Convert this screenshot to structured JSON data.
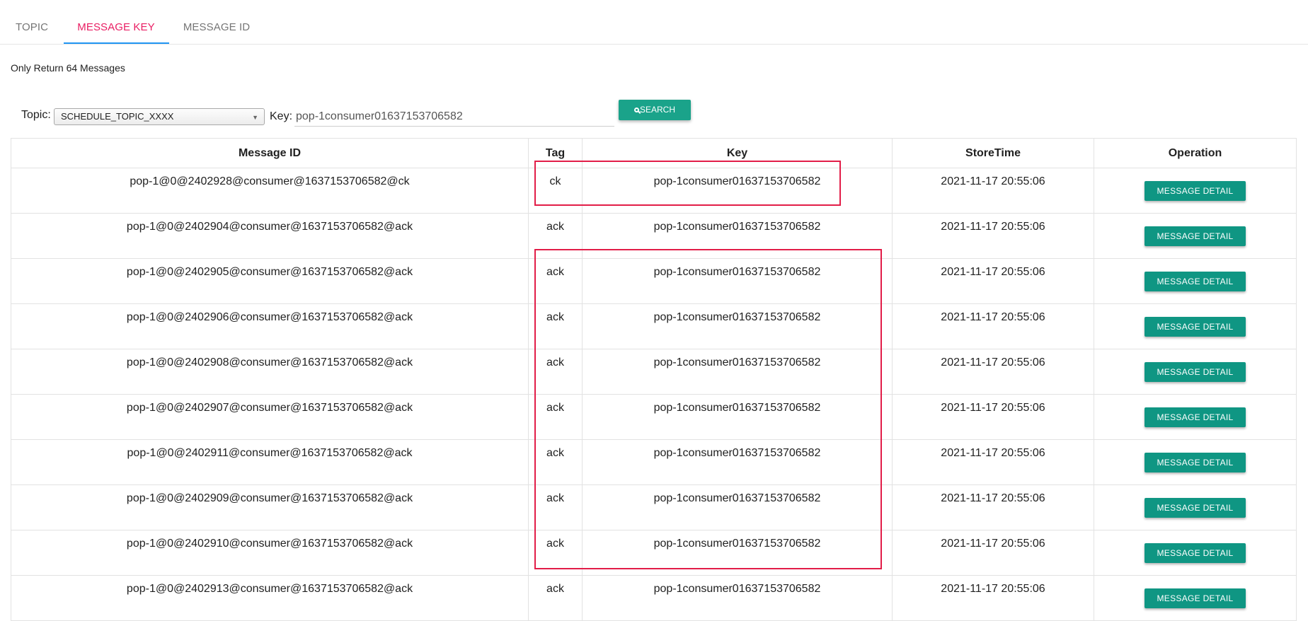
{
  "tabs": [
    {
      "label": "TOPIC"
    },
    {
      "label": "MESSAGE KEY",
      "active": true
    },
    {
      "label": "MESSAGE ID"
    }
  ],
  "note": "Only Return 64 Messages",
  "search": {
    "topic_label": "Topic:",
    "topic_value": "SCHEDULE_TOPIC_XXXX",
    "key_label": "Key:",
    "key_value": "pop-1consumer01637153706582",
    "button_label": "SEARCH"
  },
  "table": {
    "columns": [
      "Message ID",
      "Tag",
      "Key",
      "StoreTime",
      "Operation"
    ],
    "button_label": "MESSAGE DETAIL",
    "rows": [
      {
        "id": "pop-1@0@2402928@consumer@1637153706582@ck",
        "tag": "ck",
        "key": "pop-1consumer01637153706582",
        "time": "2021-11-17 20:55:06"
      },
      {
        "id": "pop-1@0@2402904@consumer@1637153706582@ack",
        "tag": "ack",
        "key": "pop-1consumer01637153706582",
        "time": "2021-11-17 20:55:06"
      },
      {
        "id": "pop-1@0@2402905@consumer@1637153706582@ack",
        "tag": "ack",
        "key": "pop-1consumer01637153706582",
        "time": "2021-11-17 20:55:06"
      },
      {
        "id": "pop-1@0@2402906@consumer@1637153706582@ack",
        "tag": "ack",
        "key": "pop-1consumer01637153706582",
        "time": "2021-11-17 20:55:06"
      },
      {
        "id": "pop-1@0@2402908@consumer@1637153706582@ack",
        "tag": "ack",
        "key": "pop-1consumer01637153706582",
        "time": "2021-11-17 20:55:06"
      },
      {
        "id": "pop-1@0@2402907@consumer@1637153706582@ack",
        "tag": "ack",
        "key": "pop-1consumer01637153706582",
        "time": "2021-11-17 20:55:06"
      },
      {
        "id": "pop-1@0@2402911@consumer@1637153706582@ack",
        "tag": "ack",
        "key": "pop-1consumer01637153706582",
        "time": "2021-11-17 20:55:06"
      },
      {
        "id": "pop-1@0@2402909@consumer@1637153706582@ack",
        "tag": "ack",
        "key": "pop-1consumer01637153706582",
        "time": "2021-11-17 20:55:06"
      },
      {
        "id": "pop-1@0@2402910@consumer@1637153706582@ack",
        "tag": "ack",
        "key": "pop-1consumer01637153706582",
        "time": "2021-11-17 20:55:06"
      },
      {
        "id": "pop-1@0@2402913@consumer@1637153706582@ack",
        "tag": "ack",
        "key": "pop-1consumer01637153706582",
        "time": "2021-11-17 20:55:06"
      }
    ]
  },
  "colors": {
    "active_tab": "#e91e63",
    "tab_indicator": "#2196f3",
    "button": "#0f9683",
    "highlight": "#e21d48"
  }
}
